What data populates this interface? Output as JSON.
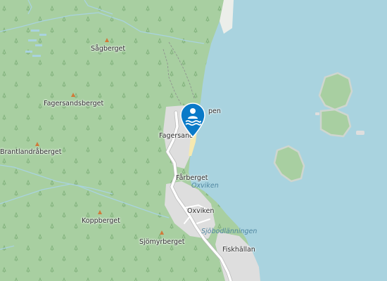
{
  "map": {
    "colors": {
      "water": "#a9d3df",
      "forest": "#a8cfa1",
      "residential": "#dedede",
      "road": "#ffffff",
      "path": "#8c8c8c",
      "stream": "#a9d3df",
      "marker": "#0a7ac8",
      "beach": "#f6e9b0"
    },
    "marker": {
      "icon": "swimming-icon",
      "label": "Fagersand"
    },
    "labels": {
      "sagberget": "Sågberget",
      "fagersandsberget": "Fagersandsberget",
      "brantlandraberget": "Brantlandråberget",
      "fagersand": "Fagersand",
      "pen": "pen",
      "farberget": "Fårberget",
      "oxviken_water": "Oxviken",
      "oxviken": "Oxviken",
      "sjobodlanningen": "Sjöbodlänningen",
      "koppberget": "Koppberget",
      "sjomyrberget": "Sjömyrberget",
      "fiskhallan": "Fiskhällan"
    }
  }
}
